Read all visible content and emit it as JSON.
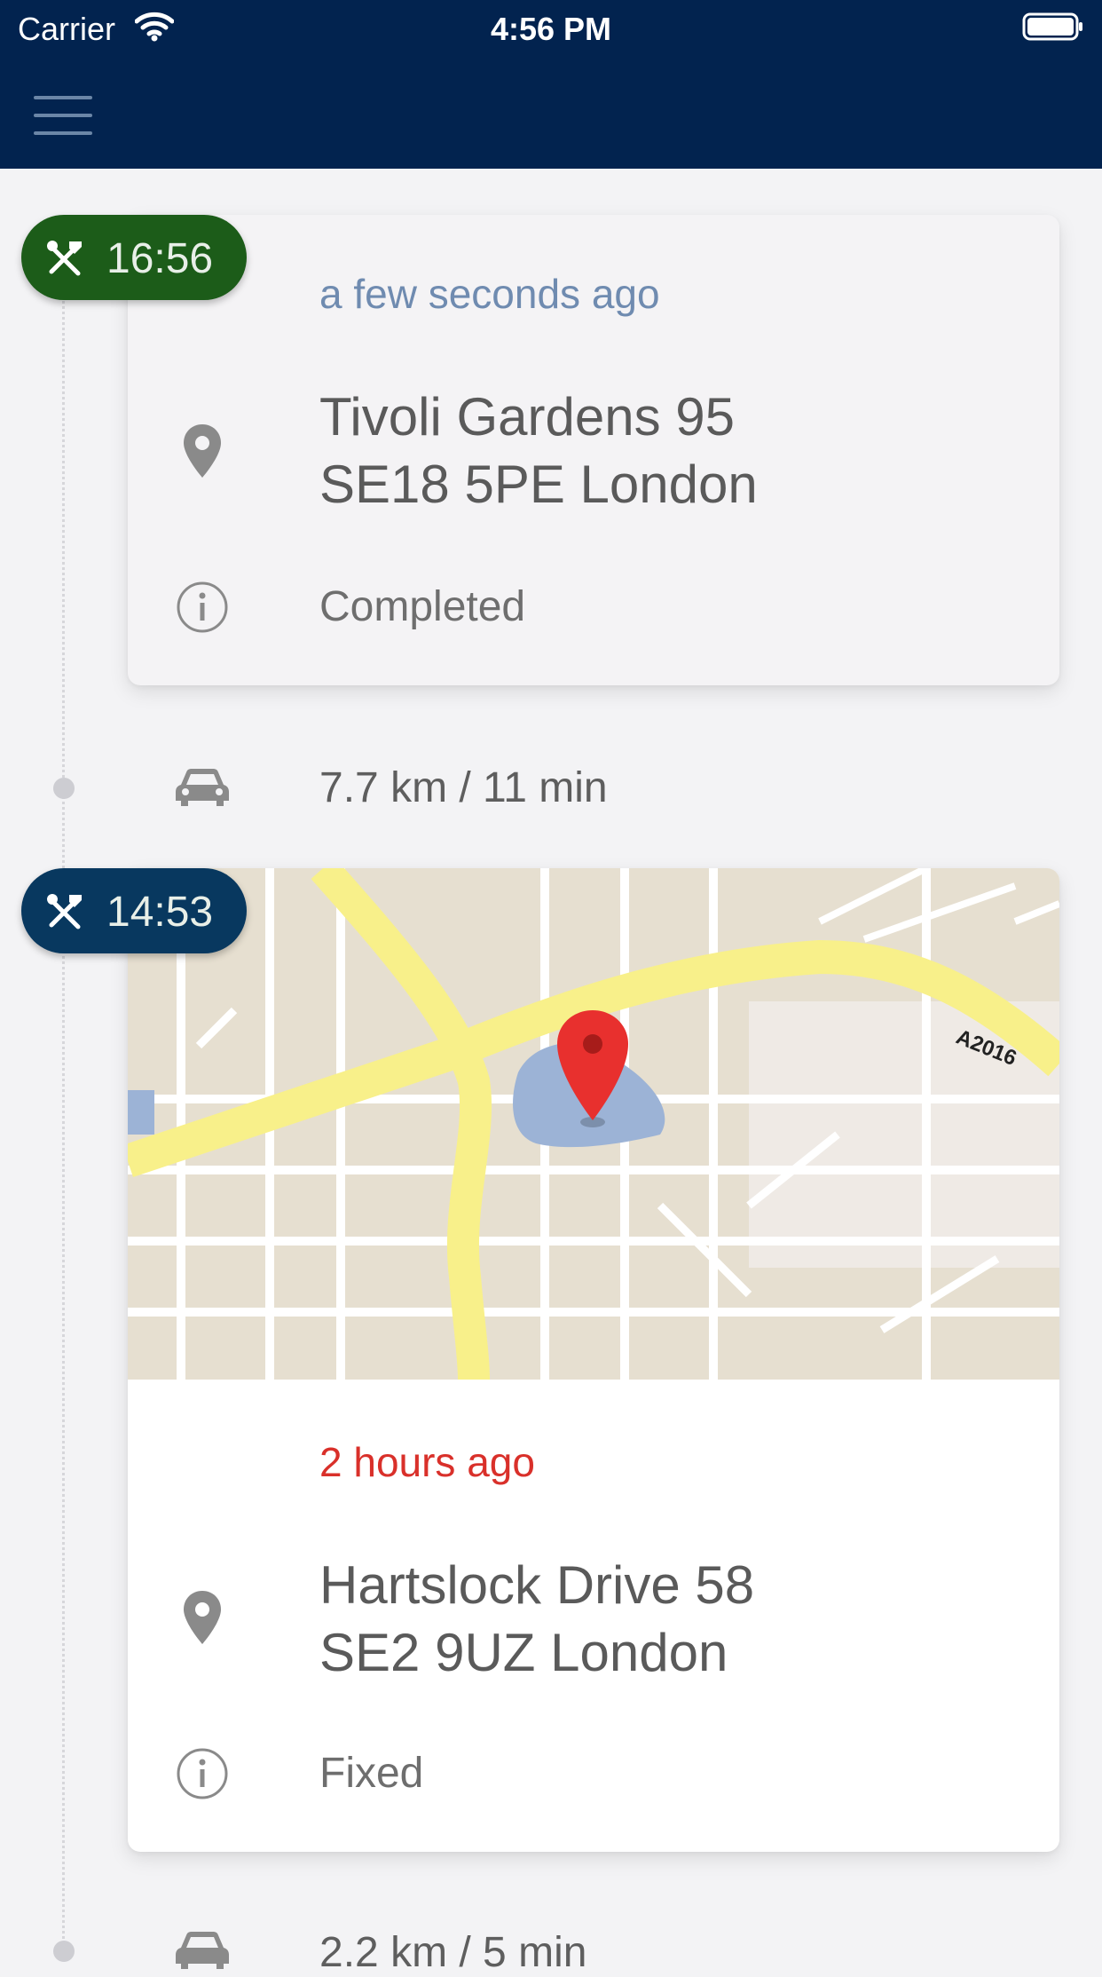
{
  "status_bar": {
    "carrier": "Carrier",
    "time": "4:56 PM"
  },
  "navbar": {
    "menu_icon": "hamburger-menu-icon"
  },
  "timeline": [
    {
      "badge_time": "16:56",
      "badge_color": "#1c5c19",
      "ago": "a few seconds ago",
      "ago_color": "#6f8bb0",
      "address_line1": "Tivoli Gardens 95",
      "address_line2": "SE18 5PE London",
      "status": "Completed",
      "has_map": false
    },
    {
      "badge_time": "14:53",
      "badge_color": "#08385f",
      "ago": "2 hours ago",
      "ago_color": "#d9302a",
      "address_line1": "Hartslock Drive 58",
      "address_line2": "SE2 9UZ London",
      "status": "Fixed",
      "has_map": true,
      "map_road_label": "A2016"
    }
  ],
  "drives": [
    {
      "text": "7.7 km / 11 min"
    },
    {
      "text": "2.2 km / 5 min"
    }
  ]
}
